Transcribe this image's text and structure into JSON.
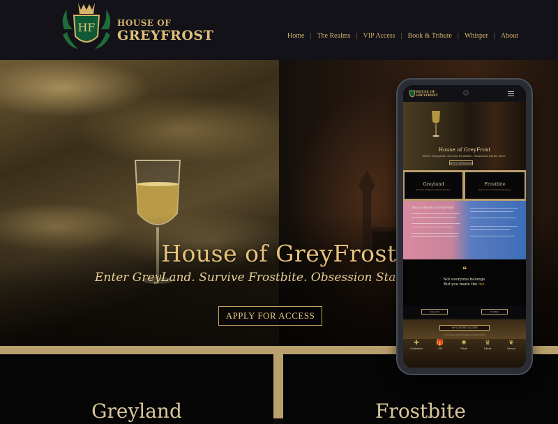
{
  "brand": {
    "of": "HOUSE OF",
    "name": "GREYFROST",
    "mark": "HF"
  },
  "nav": {
    "items": [
      "Home",
      "The Realms",
      "VIP Access",
      "Book & Tribute",
      "Whisper",
      "About"
    ]
  },
  "hero": {
    "title": "House of GreyFrost",
    "subtitle": "Enter GreyLand. Survive Frostbite. Obsession Star",
    "cta": "APPLY FOR ACCESS"
  },
  "realms": [
    {
      "title": "Greyland"
    },
    {
      "title": "Frostbite"
    }
  ],
  "mobile": {
    "hero_title": "House of GreyFrost",
    "hero_sub": "Enter GreyLand. Survive Frostbite. Obsession Starts Here.",
    "hero_cta": "APPLY FOR ACCESS",
    "cards": [
      {
        "title": "Greyland",
        "sub": "Romantic Indulgence. Tailored Devotion."
      },
      {
        "title": "Frostbite",
        "sub": "Bold Control. Unrestricted Obedience."
      }
    ],
    "about_title": "About House of GreyFrost",
    "quote_mark": "❝",
    "quote_line1": "Not everyone belongs.",
    "quote_line2a": "But you made the ",
    "quote_line2b": "list.",
    "links": [
      "GreyLand",
      "Frostbite"
    ],
    "vip_cta": "VIP CONTENT ACCESS",
    "vip_sub": "Your private portal of indulgence and obsession",
    "icons": [
      {
        "glyph": "✚",
        "label": "Confession"
      },
      {
        "glyph": "🎁",
        "label": "Gift"
      },
      {
        "glyph": "✺",
        "label": "Ritual"
      },
      {
        "glyph": "♛",
        "label": "Tribute"
      },
      {
        "glyph": "❦",
        "label": "Devour"
      }
    ]
  },
  "colors": {
    "gold": "#d6b26a",
    "accent": "#e6c27a",
    "bg": "#0b0b0d"
  }
}
